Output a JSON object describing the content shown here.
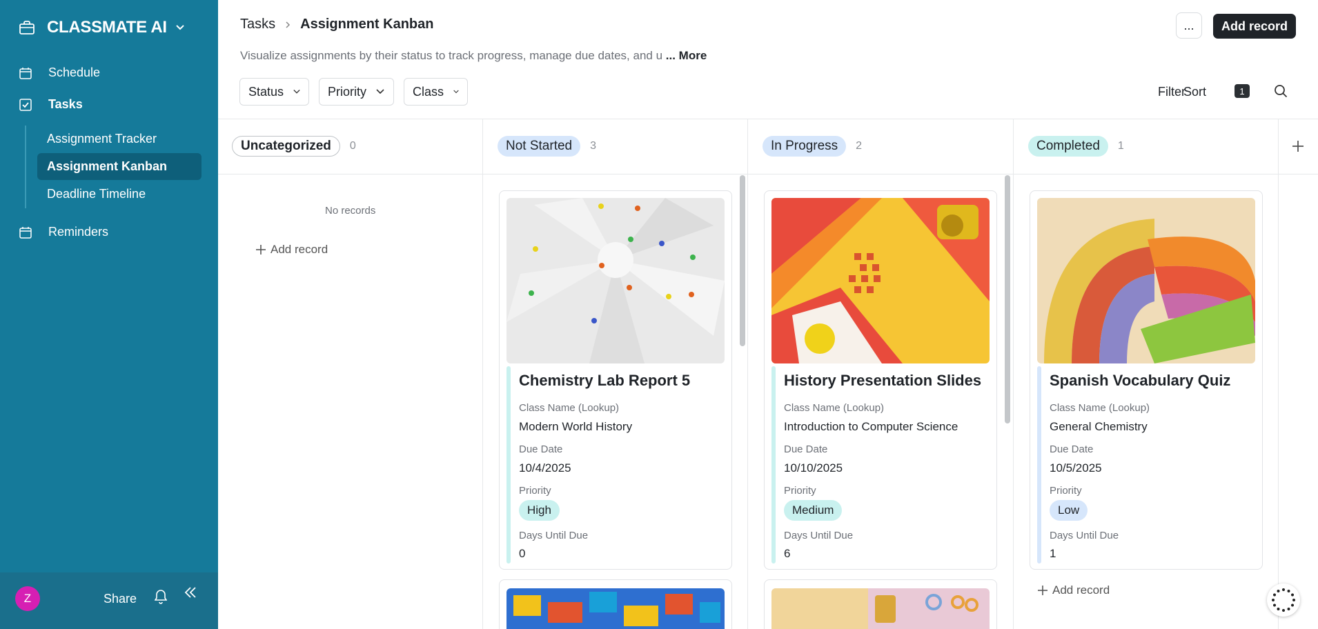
{
  "app": {
    "name": "CLASSMATE AI"
  },
  "sidebar": {
    "items": [
      {
        "label": "Schedule"
      },
      {
        "label": "Tasks"
      },
      {
        "label": "Reminders"
      }
    ],
    "sub_items": [
      {
        "label": "Assignment Tracker"
      },
      {
        "label": "Assignment Kanban"
      },
      {
        "label": "Deadline Timeline"
      }
    ],
    "footer": {
      "avatar_initial": "Z",
      "share_label": "Share"
    }
  },
  "header": {
    "breadcrumb": [
      "Tasks",
      "Assignment Kanban"
    ],
    "description": "Visualize assignments by their status to track progress, manage due dates, and u",
    "more_label": "... More",
    "more_button": "...",
    "add_record_label": "Add record"
  },
  "toolbar": {
    "filters": [
      "Status",
      "Priority",
      "Class"
    ],
    "filter_label": "Filter",
    "sort_label": "Sort",
    "sort_count": "1"
  },
  "columns": [
    {
      "label": "Uncategorized",
      "count": "0",
      "empty_text": "No records",
      "add_label": "Add record"
    },
    {
      "label": "Not Started",
      "count": "3",
      "color": "#d6e6fb"
    },
    {
      "label": "In Progress",
      "count": "2",
      "color": "#d6e6fb"
    },
    {
      "label": "Completed",
      "count": "1",
      "color": "#c9f1ef",
      "add_label": "Add record"
    }
  ],
  "cards": [
    {
      "title": "Chemistry Lab Report 5",
      "class_label": "Class Name (Lookup)",
      "class_value": "Modern World History",
      "due_label": "Due Date",
      "due_value": "10/4/2025",
      "priority_label": "Priority",
      "priority_value": "High",
      "days_label": "Days Until Due",
      "days_value": "0",
      "accent": "#c9f1ef"
    },
    {
      "title": "History Presentation Slides",
      "class_label": "Class Name (Lookup)",
      "class_value": "Introduction to Computer Science",
      "due_label": "Due Date",
      "due_value": "10/10/2025",
      "priority_label": "Priority",
      "priority_value": "Medium",
      "days_label": "Days Until Due",
      "days_value": "6",
      "accent": "#c9f1ef"
    },
    {
      "title": "Spanish Vocabulary Quiz",
      "class_label": "Class Name (Lookup)",
      "class_value": "General Chemistry",
      "due_label": "Due Date",
      "due_value": "10/5/2025",
      "priority_label": "Priority",
      "priority_value": "Low",
      "days_label": "Days Until Due",
      "days_value": "1",
      "accent": "#d6e6fb"
    }
  ]
}
